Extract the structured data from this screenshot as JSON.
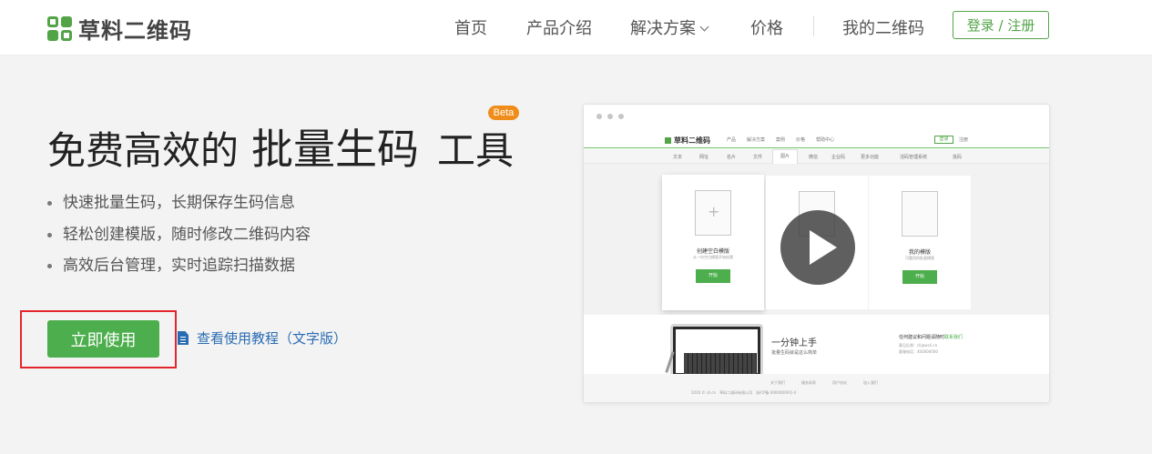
{
  "header": {
    "logo_text": "草料二维码",
    "nav": [
      "首页",
      "产品介绍",
      "解决方案",
      "价格",
      "我的二维码"
    ],
    "login_label": "登录 / 注册"
  },
  "hero": {
    "title_part1": "免费高效的",
    "title_part2": "批量生码",
    "title_part3": "工具",
    "beta": "Beta",
    "features": [
      "快速批量生码，长期保存生码信息",
      "轻松创建模版，随时修改二维码内容",
      "高效后台管理，实时追踪扫描数据"
    ],
    "cta_label": "立即使用",
    "tutorial_label": "查看使用教程（文字版）"
  },
  "preview": {
    "logo": "草料二维码",
    "nav": [
      "产品",
      "解决方案",
      "案例",
      "价格",
      "帮助中心"
    ],
    "login": "登录",
    "register": "注册",
    "tabs": [
      "文本",
      "网址",
      "名片",
      "文件",
      "图片",
      "微信",
      "企业码",
      "更多功能",
      "活码管理系统",
      "批码"
    ],
    "cards": [
      {
        "title": "创建空白模版",
        "sub": "从一份空白模版开始创建",
        "btn": "开始"
      },
      {
        "title": "",
        "sub": "",
        "btn": ""
      },
      {
        "title": "我的模版",
        "sub": "可重用的批量模版",
        "btn": "开始"
      }
    ],
    "lower_title": "一分钟上手",
    "lower_sub": "批量生码就是这么简单",
    "contact_title": "任何建议和问题请随时",
    "contact_link": "联系我们",
    "contact_email": "意见反馈：cli@wcli.cn",
    "contact_phone": "客服电话：400000000",
    "footer_links": [
      "关于我们",
      "服务条款",
      "用户协议",
      "加入我们"
    ],
    "footer_copy": "2020 © cli.cn　草料二维码有限公司　浙ICP备 00000000号-4"
  }
}
